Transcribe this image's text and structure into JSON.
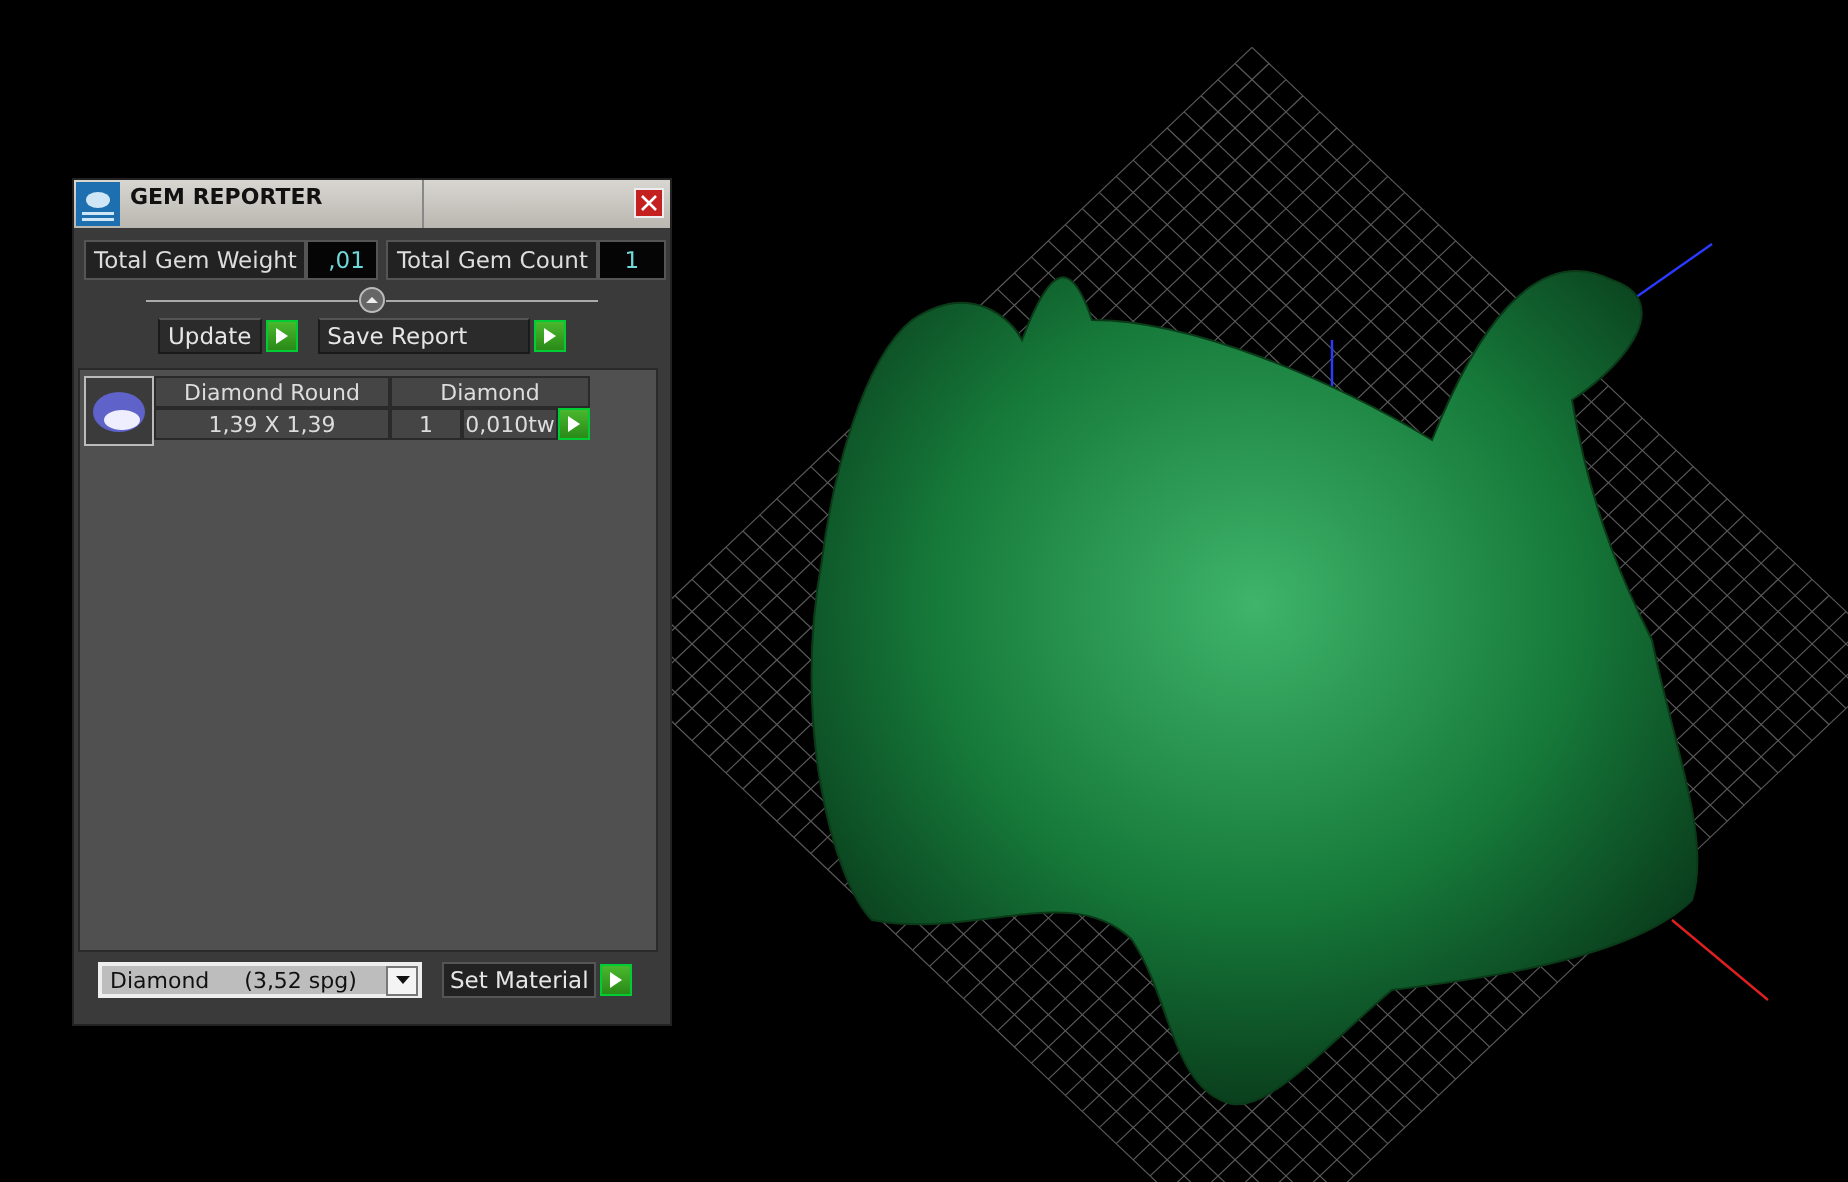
{
  "window": {
    "title": "GEM REPORTER"
  },
  "totals": [
    {
      "label": "Total Gem Weight",
      "value": ",01"
    },
    {
      "label": "Total Gem Count",
      "value": "1"
    }
  ],
  "actions": [
    "Update",
    "Save Report"
  ],
  "gems": [
    {
      "shape": "Diamond Round",
      "material": "Diamond",
      "size": "1,39 X 1,39",
      "count": "1",
      "weight": "0,010tw"
    }
  ],
  "material_select": {
    "value": "Diamond     (3,52 spg)"
  },
  "set_material_button": "Set Material"
}
